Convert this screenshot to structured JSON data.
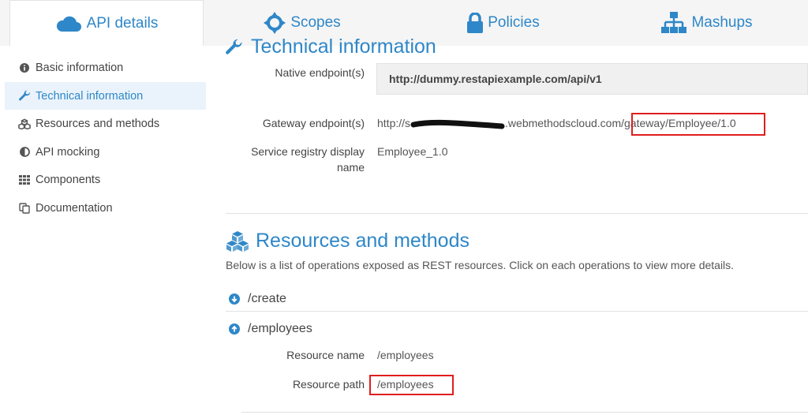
{
  "tabs": [
    {
      "label": "API details",
      "icon": "cloud-icon"
    },
    {
      "label": "Scopes",
      "icon": "crosshair-icon"
    },
    {
      "label": "Policies",
      "icon": "lock-icon"
    },
    {
      "label": "Mashups",
      "icon": "sitemap-icon"
    }
  ],
  "sidebar": {
    "items": [
      {
        "label": "Basic information",
        "icon": "info-icon"
      },
      {
        "label": "Technical information",
        "icon": "wrench-icon"
      },
      {
        "label": "Resources and methods",
        "icon": "cubes-icon"
      },
      {
        "label": "API mocking",
        "icon": "half-circle-icon"
      },
      {
        "label": "Components",
        "icon": "grid-icon"
      },
      {
        "label": "Documentation",
        "icon": "copy-icon"
      }
    ]
  },
  "technical": {
    "heading": "Technical information",
    "native_label": "Native endpoint(s)",
    "native_value": "http://dummy.restapiexample.com/api/v1",
    "gateway_label": "Gateway endpoint(s)",
    "gateway_prefix": "http://s",
    "gateway_middle": ".webmethodscloud.com",
    "gateway_path": "/gateway/Employee/1.0",
    "registry_label_line1": "Service registry display",
    "registry_label_line2": "name",
    "registry_value": "Employee_1.0"
  },
  "resources": {
    "heading": "Resources and methods",
    "description": "Below is a list of operations exposed as REST resources. Click on each operations to view more details.",
    "items": [
      {
        "path": "/create",
        "expanded": false
      },
      {
        "path": "/employees",
        "expanded": true
      }
    ],
    "detail": {
      "name_label": "Resource name",
      "name_value": "/employees",
      "path_label": "Resource path",
      "path_value": "/employees"
    }
  },
  "colors": {
    "accent": "#2e87c8",
    "highlight": "#e01e1e",
    "sidebar_active_bg": "#eaf3fb",
    "tabbar_bg": "#f5f5f5"
  }
}
